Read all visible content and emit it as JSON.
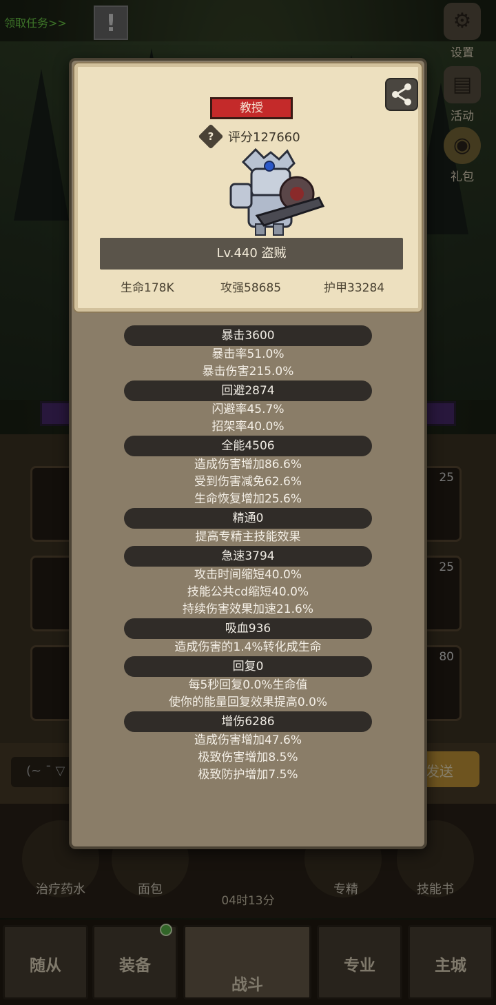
{
  "hud": {
    "quest_link": "领取任务>>",
    "alert_glyph": "!",
    "side_buttons": [
      {
        "label": "设置",
        "icon": "gear-icon"
      },
      {
        "label": "活动",
        "icon": "scroll-icon"
      },
      {
        "label": "礼包",
        "icon": "gift-icon"
      }
    ]
  },
  "background": {
    "slot_numbers": [
      "25",
      "25",
      "80"
    ],
    "chat_input": "(~ ¯ ▽",
    "send_label": "发送",
    "items": [
      "治疗药水",
      "面包",
      "专精",
      "技能书"
    ],
    "timer": "04时13分",
    "tabs": [
      "随从",
      "装备",
      "战斗",
      "专业",
      "主城"
    ]
  },
  "popup": {
    "title_badge": "教授",
    "score": "评分127660",
    "help_glyph": "?",
    "level_class": "Lv.440 盗贼",
    "stats": {
      "hp": "生命178K",
      "attack": "攻强58685",
      "armor": "护甲33284"
    },
    "attributes": [
      {
        "header": "暴击3600",
        "lines": [
          "暴击率51.0%",
          "暴击伤害215.0%"
        ]
      },
      {
        "header": "回避2874",
        "lines": [
          "闪避率45.7%",
          "招架率40.0%"
        ]
      },
      {
        "header": "全能4506",
        "lines": [
          "造成伤害增加86.6%",
          "受到伤害减免62.6%",
          "生命恢复增加25.6%"
        ]
      },
      {
        "header": "精通0",
        "lines": [
          "提高专精主技能效果"
        ]
      },
      {
        "header": "急速3794",
        "lines": [
          "攻击时间缩短40.0%",
          "技能公共cd缩短40.0%",
          "持续伤害效果加速21.6%"
        ]
      },
      {
        "header": "吸血936",
        "lines": [
          "造成伤害的1.4%转化成生命"
        ]
      },
      {
        "header": "回复0",
        "lines": [
          "每5秒回复0.0%生命值",
          "使你的能量回复效果提高0.0%"
        ]
      },
      {
        "header": "增伤6286",
        "lines": [
          "造成伤害增加47.6%",
          "极致伤害增加8.5%",
          "极致防护增加7.5%"
        ]
      }
    ]
  }
}
